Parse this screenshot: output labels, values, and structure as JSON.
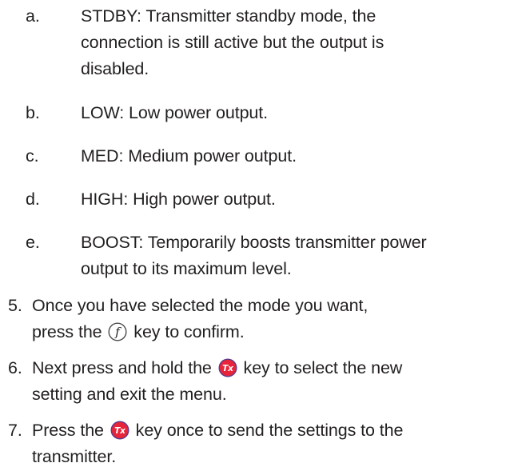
{
  "sub_items": [
    {
      "marker": "a.",
      "lines": [
        "STDBY: Transmitter standby mode, the",
        "connection is still active but the output is",
        "disabled."
      ]
    },
    {
      "marker": "b.",
      "lines": [
        "LOW: Low power output."
      ]
    },
    {
      "marker": "c.",
      "lines": [
        "MED: Medium power output."
      ]
    },
    {
      "marker": "d.",
      "lines": [
        "HIGH: High power output."
      ]
    },
    {
      "marker": "e.",
      "lines": [
        "BOOST: Temporarily boosts transmitter power",
        "output to its maximum level."
      ]
    }
  ],
  "steps": [
    {
      "marker": "5.",
      "line1_before": "Once you have selected the mode you want,",
      "line2_before": "press the",
      "key": "f-key-icon",
      "line2_after": "key to confirm."
    },
    {
      "marker": "6.",
      "line1_before": "Next press and hold the",
      "key": "tx-key-icon",
      "line1_after": "key to select the new",
      "line2": "setting and exit the menu."
    },
    {
      "marker": "7.",
      "line1_before": "Press the",
      "key": "tx-key-icon",
      "line1_after": "key once to send the settings to the",
      "line2": "transmitter."
    }
  ],
  "colors": {
    "text": "#231f20",
    "tx_key_fill": "#e7243a",
    "tx_key_border": "#5b3b8c",
    "f_key_border": "#4b4b4b"
  }
}
